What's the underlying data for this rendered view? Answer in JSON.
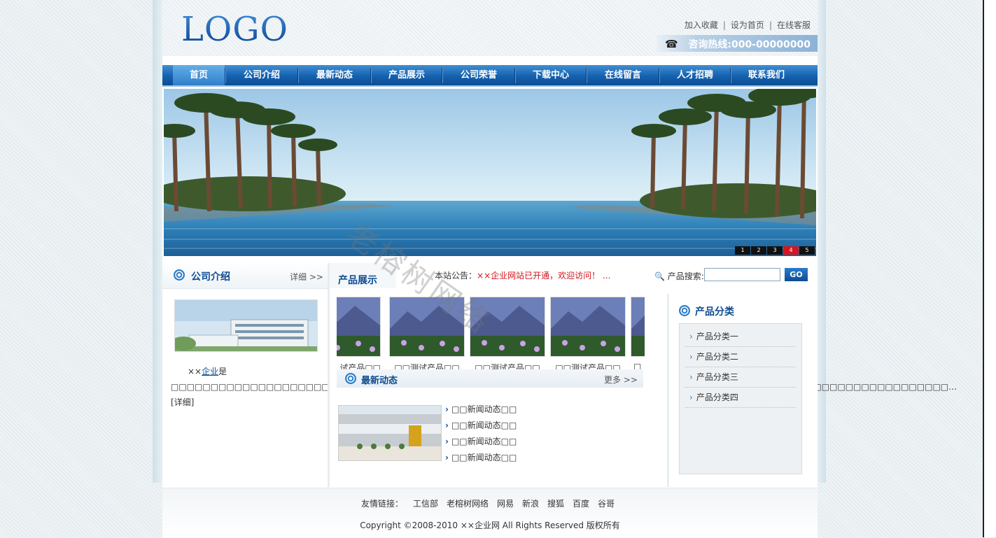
{
  "header": {
    "logo": "LOGO",
    "links": [
      "加入收藏",
      "设为首页",
      "在线客服"
    ],
    "separator": "|",
    "hotline": "咨询热线:000-00000000",
    "phone_icon": "☎"
  },
  "nav": [
    "首页",
    "公司介绍",
    "最新动态",
    "产品展示",
    "公司荣誉",
    "下载中心",
    "在线留言",
    "人才招聘",
    "联系我们"
  ],
  "banner": {
    "pages": [
      "1",
      "2",
      "3",
      "4",
      "5"
    ],
    "active_page": "4"
  },
  "about": {
    "title": "公司介绍",
    "more": "详细 >>",
    "text_prefix": "××",
    "text_link": "企业",
    "text_body": "是□□□□□□□□□□□□□□□□□□□□□□□□□□□□□□□□□□□□□□□□□□□□□□□□□□□□□□□□□□□□□□□□□□□□□□□□□□□□□□□□□□□□□□□□□□□□□□□□□□…",
    "detail": "[详细]"
  },
  "products": {
    "title": "产品展示",
    "notice_label": "本站公告：",
    "notice_text": "××企业网站已开通，欢迎访问！ ...",
    "items": [
      "试产品□□",
      "□□测试产品□□",
      "□□测试产品□□",
      "□□测试产品□□",
      "□"
    ]
  },
  "news": {
    "title": "最新动态",
    "more": "更多 >>",
    "items": [
      "□□新闻动态□□",
      "□□新闻动态□□",
      "□□新闻动态□□",
      "□□新闻动态□□"
    ]
  },
  "search": {
    "label": "产品搜索:",
    "button": "GO",
    "value": ""
  },
  "categories": {
    "title": "产品分类",
    "items": [
      "产品分类一",
      "产品分类二",
      "产品分类三",
      "产品分类四"
    ]
  },
  "footer": {
    "links_label": "友情链接：",
    "links": [
      "工信部",
      "老榕树网络",
      "网易",
      "新浪",
      "搜狐",
      "百度",
      "谷哥"
    ],
    "copyright": "Copyright ©2008-2010 ××企业网  All Rights Reserved 版权所有"
  },
  "watermark": "老榕树网络",
  "colors": {
    "nav_blue": "#1561ae",
    "title_blue": "#0d4c91",
    "notice_red": "#d2161e",
    "active_page_red": "#d6161f"
  }
}
